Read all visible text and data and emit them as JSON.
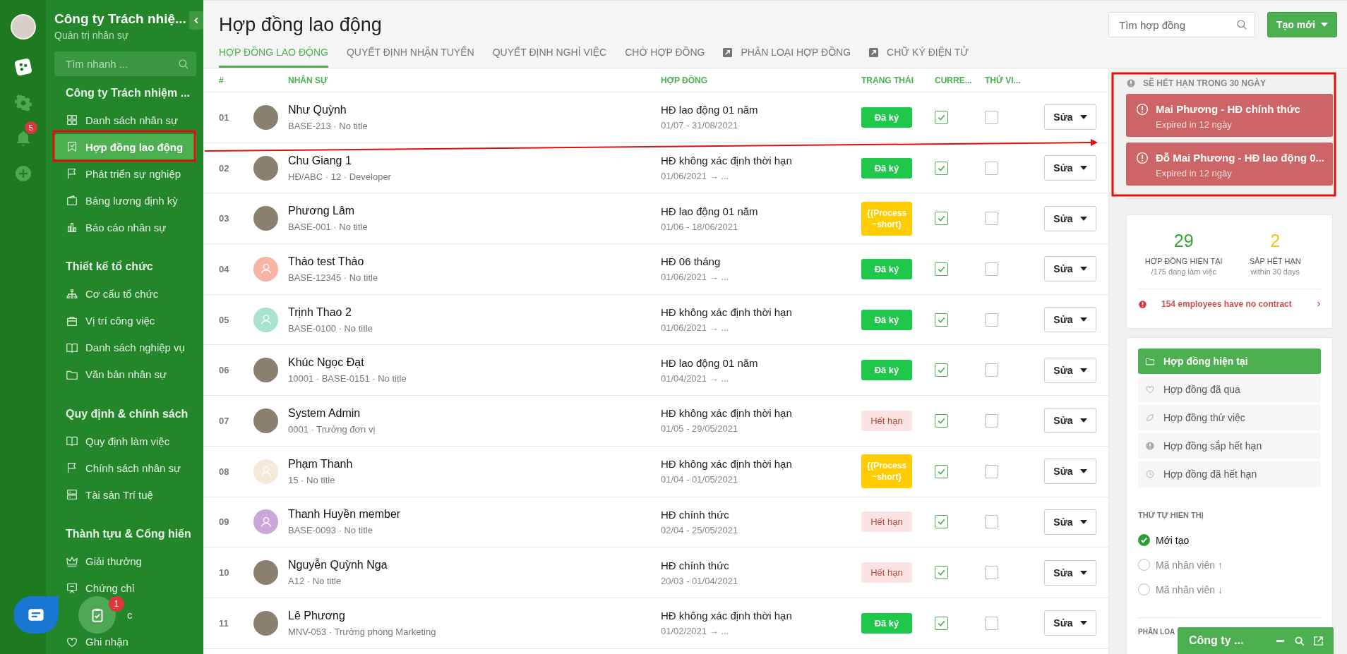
{
  "rail": {
    "notification_badge": "5"
  },
  "sidebar": {
    "title": "Công ty Trách nhiệ...",
    "subtitle": "Quản trị nhân sự",
    "search_placeholder": "Tìm nhanh ...",
    "sections": [
      {
        "heading": "Công ty Trách nhiệm ...",
        "items": [
          {
            "label": "Danh sách nhân sự",
            "selected": false
          },
          {
            "label": "Hợp đồng lao động",
            "selected": true
          },
          {
            "label": "Phát triển sự nghiệp",
            "selected": false
          },
          {
            "label": "Bảng lương định kỳ",
            "selected": false
          },
          {
            "label": "Báo cáo nhân sự",
            "selected": false
          }
        ]
      },
      {
        "heading": "Thiết kế tổ chức",
        "items": [
          {
            "label": "Cơ cấu tổ chức",
            "selected": false
          },
          {
            "label": "Vị trí công việc",
            "selected": false
          },
          {
            "label": "Danh sách nghiệp vụ",
            "selected": false
          },
          {
            "label": "Văn bản nhân sự",
            "selected": false
          }
        ]
      },
      {
        "heading": "Quy định & chính sách",
        "items": [
          {
            "label": "Quy định làm việc",
            "selected": false
          },
          {
            "label": "Chính sách nhân sự",
            "selected": false
          },
          {
            "label": "Tài sản Trí tuệ",
            "selected": false
          }
        ]
      },
      {
        "heading": "Thành tựu & Cống hiến",
        "items": [
          {
            "label": "Giải thưởng",
            "selected": false
          },
          {
            "label": "Chứng chỉ",
            "selected": false
          },
          {
            "label": "c",
            "selected": false,
            "covered": true
          },
          {
            "label": "Ghi nhận",
            "selected": false
          }
        ]
      }
    ]
  },
  "page": {
    "title": "Hợp đồng lao động",
    "search_placeholder": "Tìm hợp đồng",
    "create_button": "Tạo mới",
    "tabs": [
      {
        "label": "HỢP ĐỒNG LAO ĐỘNG",
        "selected": true,
        "external": false
      },
      {
        "label": "QUYẾT ĐỊNH NHẬN TUYỂN",
        "selected": false,
        "external": false
      },
      {
        "label": "QUYẾT ĐỊNH NGHỈ VIỆC",
        "selected": false,
        "external": false
      },
      {
        "label": "CHỜ HỢP ĐỒNG",
        "selected": false,
        "external": false
      },
      {
        "label": "PHÂN LOẠI HỢP ĐỒNG",
        "selected": false,
        "external": true
      },
      {
        "label": "CHỮ KÝ ĐIỆN TỬ",
        "selected": false,
        "external": true
      }
    ]
  },
  "table": {
    "columns": [
      "#",
      "NHÂN SỰ",
      "HỢP ĐỒNG",
      "TRẠNG THÁI",
      "CURRE...",
      "THỬ VI..."
    ],
    "rows": [
      {
        "index": "01",
        "name": "Như Quỳnh",
        "meta": "BASE-213 · No title",
        "avatar": {
          "kind": "photo"
        },
        "contract": "HĐ lao động 01 năm",
        "period": "01/07 - 31/08/2021",
        "status": {
          "kind": "signed",
          "label": "Đã ký"
        },
        "current": true,
        "probation": false,
        "action": "Sửa"
      },
      {
        "index": "02",
        "name": "Chu Giang 1",
        "meta": "HĐ/ABC · 12 · Developer",
        "avatar": {
          "kind": "photo"
        },
        "contract": "HĐ không xác định thời hạn",
        "period": "01/06/2021 → ...",
        "status": {
          "kind": "signed",
          "label": "Đã ký"
        },
        "current": true,
        "probation": false,
        "action": "Sửa"
      },
      {
        "index": "03",
        "name": "Phương Lâm",
        "meta": "BASE-001 · No title",
        "avatar": {
          "kind": "photo"
        },
        "contract": "HĐ lao động 01 năm",
        "period": "01/06 - 18/06/2021",
        "status": {
          "kind": "process",
          "label": "{{Process ~short}"
        },
        "current": true,
        "probation": false,
        "action": "Sửa"
      },
      {
        "index": "04",
        "name": "Thảo test Thảo",
        "meta": "BASE-12345 · No title",
        "avatar": {
          "kind": "default",
          "color": "#f7b3a3"
        },
        "contract": "HĐ 06 tháng",
        "period": "01/06/2021 → ...",
        "status": {
          "kind": "signed",
          "label": "Đã ký"
        },
        "current": true,
        "probation": false,
        "action": "Sửa"
      },
      {
        "index": "05",
        "name": "Trịnh Thao 2",
        "meta": "BASE-0100 · No title",
        "avatar": {
          "kind": "default",
          "color": "#a9e2d1"
        },
        "contract": "HĐ không xác định thời hạn",
        "period": "01/06/2021 → ...",
        "status": {
          "kind": "signed",
          "label": "Đã ký"
        },
        "current": true,
        "probation": false,
        "action": "Sửa"
      },
      {
        "index": "06",
        "name": "Khúc Ngọc Đạt",
        "meta": "10001 · BASE-0151 · No title",
        "avatar": {
          "kind": "photo"
        },
        "contract": "HĐ lao động 01 năm",
        "period": "01/04/2021 → ...",
        "status": {
          "kind": "signed",
          "label": "Đã ký"
        },
        "current": true,
        "probation": false,
        "action": "Sửa"
      },
      {
        "index": "07",
        "name": "System Admin",
        "meta": "0001 · Trưởng đơn vị",
        "avatar": {
          "kind": "photo"
        },
        "contract": "HĐ không xác định thời hạn",
        "period": "01/05 - 29/05/2021",
        "status": {
          "kind": "expired",
          "label": "Hết hạn"
        },
        "current": true,
        "probation": false,
        "action": "Sửa"
      },
      {
        "index": "08",
        "name": "Phạm Thanh",
        "meta": "15 · No title",
        "avatar": {
          "kind": "default",
          "color": "#f3ead9"
        },
        "contract": "HĐ không xác định thời hạn",
        "period": "01/04 - 01/05/2021",
        "status": {
          "kind": "process",
          "label": "{{Process ~short}"
        },
        "current": true,
        "probation": false,
        "action": "Sửa"
      },
      {
        "index": "09",
        "name": "Thanh Huyền member",
        "meta": "BASE-0093 · No title",
        "avatar": {
          "kind": "default",
          "color": "#caa6da"
        },
        "contract": "HĐ chính thức",
        "period": "02/04 - 25/05/2021",
        "status": {
          "kind": "expired",
          "label": "Hết hạn"
        },
        "current": true,
        "probation": false,
        "action": "Sửa"
      },
      {
        "index": "10",
        "name": "Nguyễn Quỳnh Nga",
        "meta": "A12 · No title",
        "avatar": {
          "kind": "photo"
        },
        "contract": "HĐ chính thức",
        "period": "20/03 - 01/04/2021",
        "status": {
          "kind": "expired",
          "label": "Hết hạn"
        },
        "current": true,
        "probation": false,
        "action": "Sửa"
      },
      {
        "index": "11",
        "name": "Lê Phương",
        "meta": "MNV-053 · Trưởng phòng Marketing",
        "avatar": {
          "kind": "photo"
        },
        "contract": "HĐ không xác định thời hạn",
        "period": "01/02/2021 → ...",
        "status": {
          "kind": "signed",
          "label": "Đã ký"
        },
        "current": true,
        "probation": false,
        "action": "Sửa"
      }
    ]
  },
  "expiring": {
    "heading": "SẼ HẾT HẠN TRONG 30 NGÀY",
    "alerts": [
      {
        "title": "Mai Phương - HĐ chính thức",
        "subtitle": "Expired in 12 ngày"
      },
      {
        "title": "Đỗ Mai Phương - HĐ lao động 0...",
        "subtitle": "Expired in 12 ngày"
      }
    ]
  },
  "stats": {
    "items": [
      {
        "kind": "current",
        "value": "29",
        "label": "HỢP ĐỒNG HIỆN TẠI",
        "sublabel": "/175 đang làm việc"
      },
      {
        "kind": "expiring",
        "value": "2",
        "label": "SẮP HẾT HẠN",
        "sublabel": "within 30 days"
      }
    ],
    "notice": "154 employees have no contract"
  },
  "filters": [
    {
      "label": "Hợp đồng hiện tại",
      "selected": true
    },
    {
      "label": "Hợp đồng đã qua",
      "selected": false
    },
    {
      "label": "Hợp đồng thử việc",
      "selected": false
    },
    {
      "label": "Hợp đồng sắp hết hạn",
      "selected": false
    },
    {
      "label": "Hợp đồng đã hết hạn",
      "selected": false
    }
  ],
  "sort": {
    "heading": "THỨ TỰ HIỂN THỊ",
    "options": [
      {
        "label": "Mới tạo",
        "selected": true
      },
      {
        "label": "Mã nhân viên ↑",
        "selected": false
      },
      {
        "label": "Mã nhân viên ↓",
        "selected": false
      }
    ]
  },
  "category_heading": "PHÂN LOA",
  "chat_widget": {
    "title": "Công ty ..."
  },
  "task_badge": "1"
}
